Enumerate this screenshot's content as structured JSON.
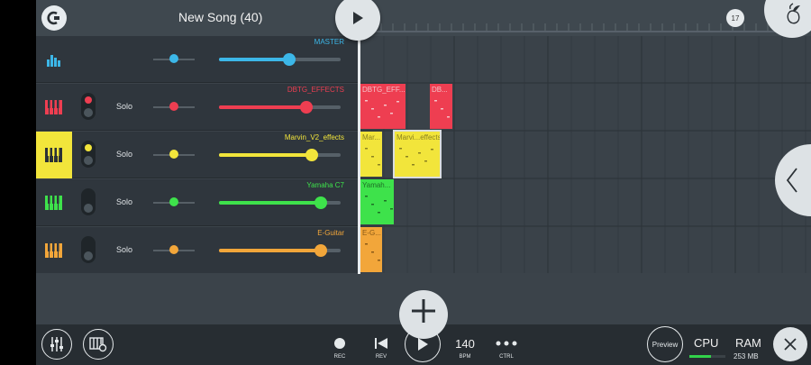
{
  "header": {
    "song_title": "New Song (40)",
    "position_marker": "17",
    "icons": {
      "logo": "fl-logo-icon",
      "play": "play-icon",
      "fruit": "fl-fruit-icon"
    }
  },
  "tracks": [
    {
      "name": "MASTER",
      "color": "#3cb7e8",
      "solo_label": "",
      "pan": 0.5,
      "volume": 0.58,
      "mute_led": false
    },
    {
      "name": "DBTG_EFFECTS",
      "color": "#ee3e51",
      "solo_label": "Solo",
      "pan": 0.5,
      "volume": 0.72,
      "mute_led": true
    },
    {
      "name": "Marvin_V2_effects",
      "color": "#f2e53b",
      "solo_label": "Solo",
      "pan": 0.5,
      "volume": 0.76,
      "mute_led": true
    },
    {
      "name": "Yamaha C7",
      "color": "#3ee24b",
      "solo_label": "Solo",
      "pan": 0.5,
      "volume": 0.84,
      "mute_led": false
    },
    {
      "name": "E-Guitar",
      "color": "#f2a63a",
      "solo_label": "Solo",
      "pan": 0.5,
      "volume": 0.84,
      "mute_led": false
    }
  ],
  "clips": [
    {
      "label": "DBTG_EFF...",
      "color": "#ee3e51",
      "text_color": "#f4c2c8"
    },
    {
      "label": "DB...",
      "color": "#ee3e51",
      "text_color": "#f4c2c8"
    },
    {
      "label": "Mar...",
      "color": "#f2e53b",
      "text_color": "#8a8120"
    },
    {
      "label": "Marvi...effects",
      "color": "#f2e53b",
      "text_color": "#8a8120"
    },
    {
      "label": "Yamah...",
      "color": "#3ee24b",
      "text_color": "#1e6f26"
    },
    {
      "label": "E-G...",
      "color": "#f2a63a",
      "text_color": "#8a5a17"
    }
  ],
  "toolbar": {
    "rec": "REC",
    "rev": "REV",
    "bpm_value": "140",
    "bpm_caption": "BPM",
    "ctrl": "CTRL",
    "preview": "Preview",
    "cpu": "CPU",
    "cpu_load": 0.6,
    "ram": "RAM",
    "ram_size": "253 MB"
  },
  "colors": {
    "accent": "#dfe4e7",
    "panel": "#2f363d",
    "grid": "#3a4249"
  }
}
